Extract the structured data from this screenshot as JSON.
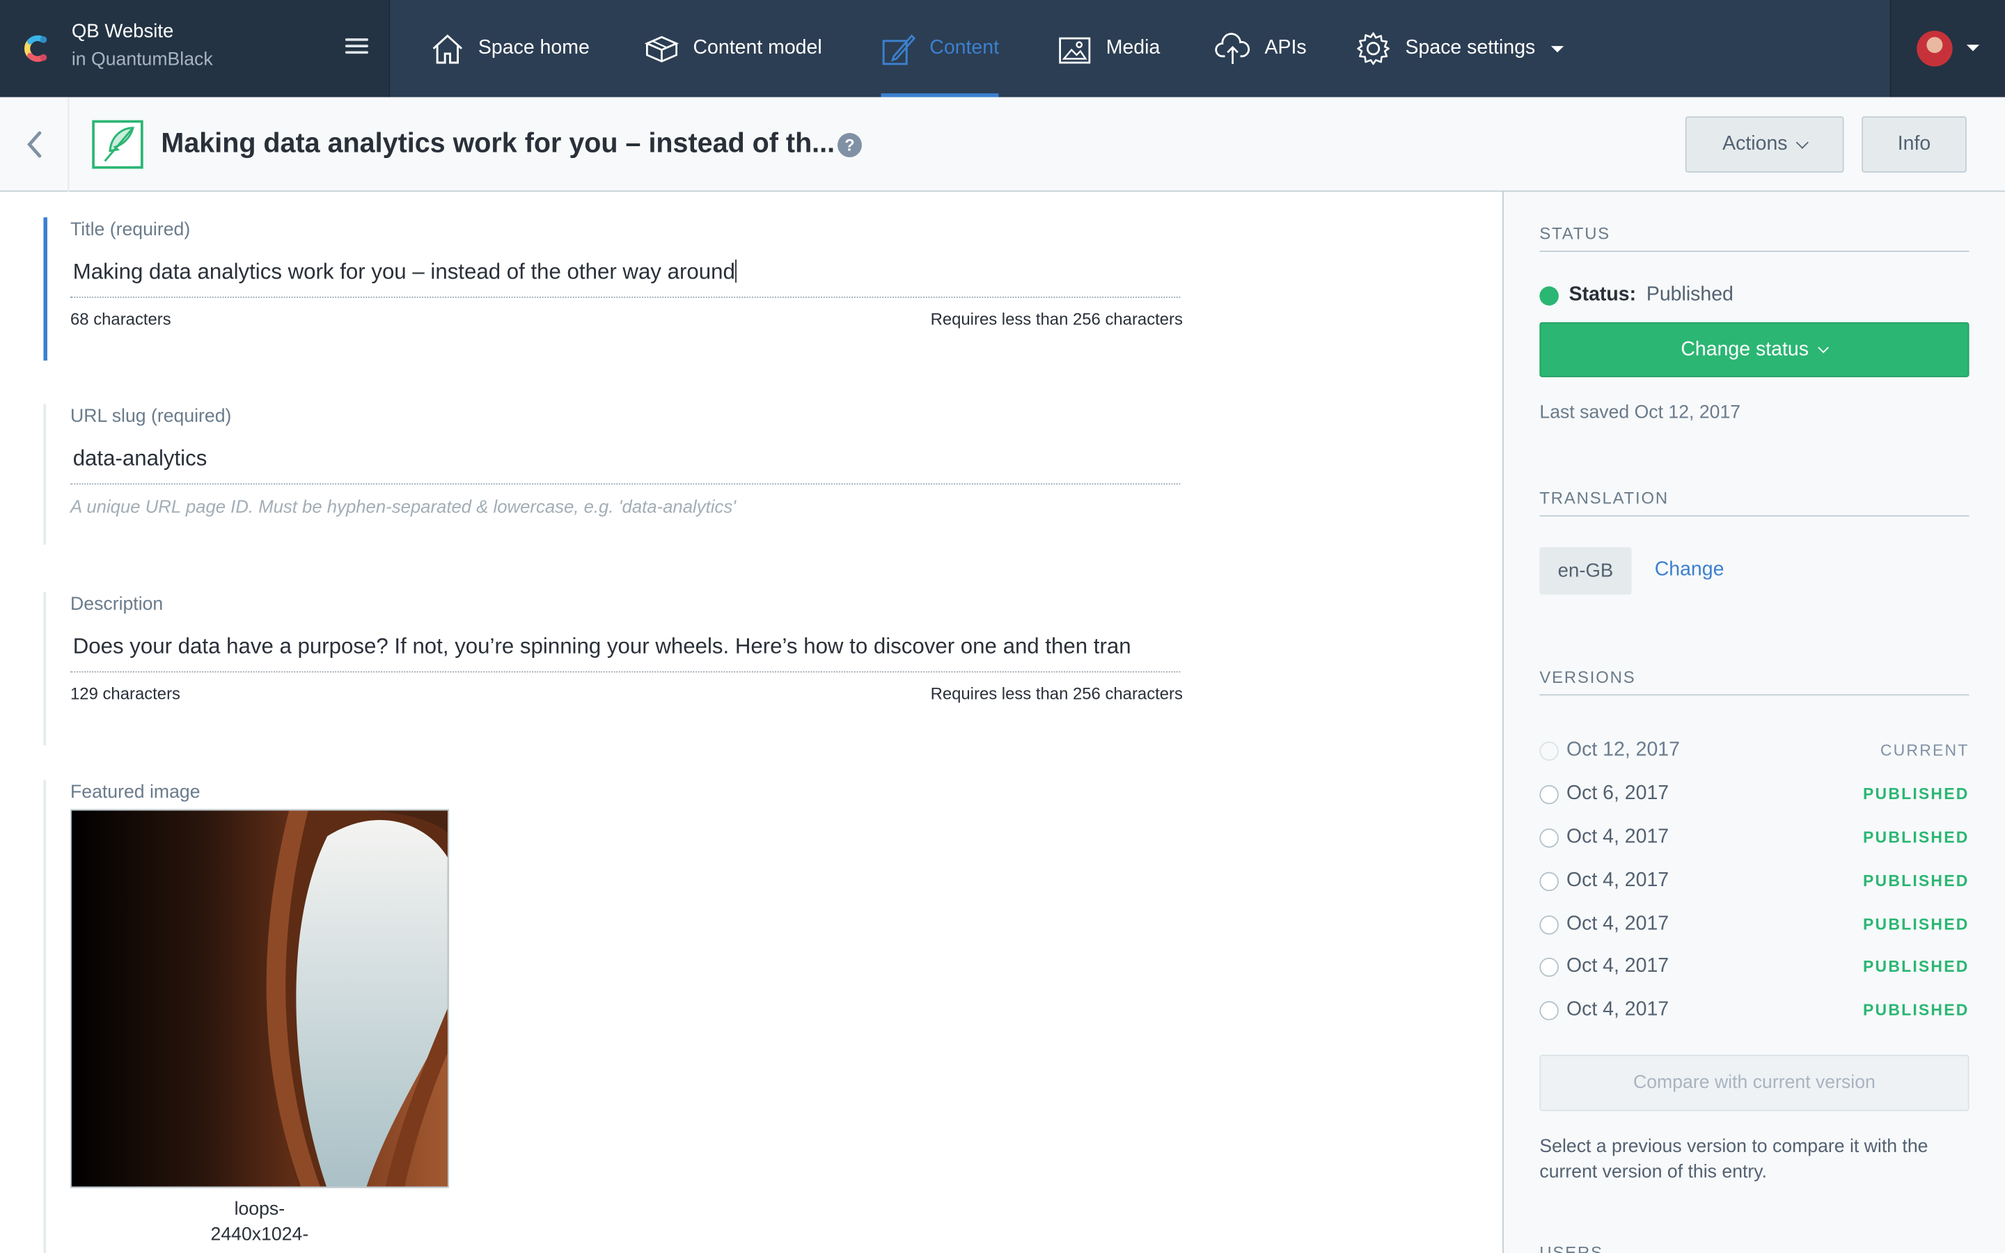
{
  "topbar": {
    "space_name": "QB Website",
    "space_org": "in QuantumBlack",
    "nav": [
      {
        "label": "Space home",
        "icon": "home-icon"
      },
      {
        "label": "Content model",
        "icon": "box-icon"
      },
      {
        "label": "Content",
        "icon": "edit-icon",
        "active": true
      },
      {
        "label": "Media",
        "icon": "image-icon"
      },
      {
        "label": "APIs",
        "icon": "cloud-upload-icon"
      },
      {
        "label": "Space settings",
        "icon": "gear-icon"
      }
    ],
    "active_color": "#3c80cf"
  },
  "entry": {
    "title": "Making data analytics work for you – instead of th...",
    "actions_label": "Actions",
    "info_label": "Info"
  },
  "fields": {
    "title": {
      "label": "Title (required)",
      "value": "Making data analytics work for you – instead of the other way around",
      "count": "68 characters",
      "limit": "Requires less than 256 characters"
    },
    "slug": {
      "label": "URL slug (required)",
      "value": "data-analytics",
      "help": "A unique URL page ID. Must be hyphen-separated & lowercase, e.g. 'data-analytics'"
    },
    "description": {
      "label": "Description",
      "value": "Does your data have a purpose? If not, you’re spinning your wheels. Here’s how to discover one and then tran",
      "count": "129 characters",
      "limit": "Requires less than 256 characters"
    },
    "featured_image": {
      "label": "Featured image",
      "caption_line1": "loops-",
      "caption_line2": "2440x1024-"
    }
  },
  "sidebar": {
    "status_heading": "STATUS",
    "status_label": "Status:",
    "status_value": "Published",
    "change_status_label": "Change status",
    "last_saved": "Last saved Oct 12, 2017",
    "translation_heading": "TRANSLATION",
    "locale": "en-GB",
    "locale_change": "Change",
    "versions_heading": "VERSIONS",
    "versions": [
      {
        "date": "Oct 12, 2017",
        "tag": "CURRENT"
      },
      {
        "date": "Oct 6, 2017",
        "tag": "PUBLISHED"
      },
      {
        "date": "Oct 4, 2017",
        "tag": "PUBLISHED"
      },
      {
        "date": "Oct 4, 2017",
        "tag": "PUBLISHED"
      },
      {
        "date": "Oct 4, 2017",
        "tag": "PUBLISHED"
      },
      {
        "date": "Oct 4, 2017",
        "tag": "PUBLISHED"
      },
      {
        "date": "Oct 4, 2017",
        "tag": "PUBLISHED"
      }
    ],
    "compare_label": "Compare with current version",
    "compare_help": "Select a previous version to compare it with the current version of this entry.",
    "next_heading": "USERS"
  },
  "colors": {
    "published_green": "#2bb673",
    "nav_bg": "#2c3e53",
    "link_blue": "#3c80cf"
  }
}
